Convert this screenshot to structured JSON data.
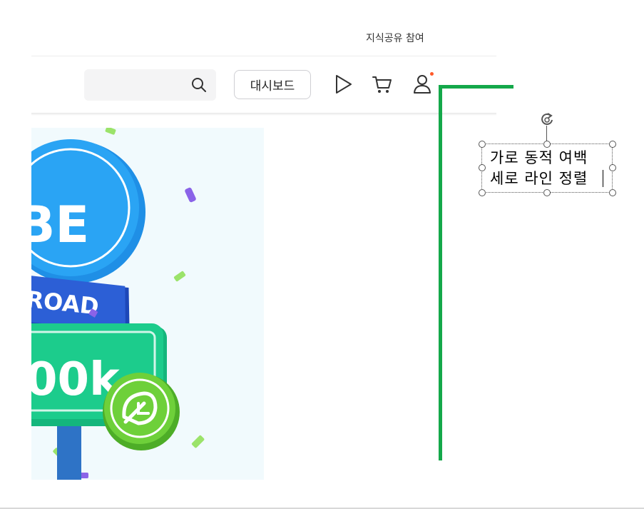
{
  "header": {
    "top_link": "지식공유 참여",
    "search": {
      "placeholder": ""
    },
    "dashboard_label": "대시보드",
    "icons": [
      "search-icon",
      "play-icon",
      "cart-icon",
      "user-icon"
    ],
    "notification_dot_color": "#ff5a2a"
  },
  "banner": {
    "texts": [
      "BE",
      "ROAD",
      "00k"
    ],
    "bg_color": "#f1fafd"
  },
  "textbox": {
    "line1": "가로 동적 여백",
    "line2": "세로 라인 정렬"
  },
  "colors": {
    "guide_line": "#14a84a"
  }
}
